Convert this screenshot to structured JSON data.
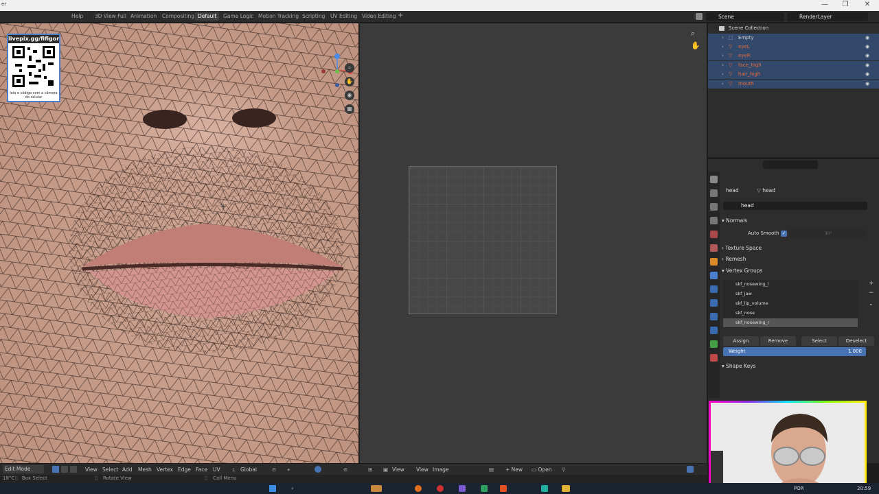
{
  "window": {
    "title_left": "er",
    "controls": [
      "—",
      "❐",
      "✕"
    ]
  },
  "menu": {
    "help": "Help"
  },
  "workspaces": [
    {
      "label": "3D View Full",
      "active": false
    },
    {
      "label": "Animation",
      "active": false
    },
    {
      "label": "Compositing",
      "active": false
    },
    {
      "label": "Default",
      "active": true
    },
    {
      "label": "Game Logic",
      "active": false
    },
    {
      "label": "Motion Tracking",
      "active": false
    },
    {
      "label": "Scripting",
      "active": false
    },
    {
      "label": "UV Editing",
      "active": false
    },
    {
      "label": "Video Editing",
      "active": false
    }
  ],
  "add_workspace": "+",
  "scene": {
    "label": "Scene"
  },
  "renderlayer": {
    "label": "RenderLayer"
  },
  "overlay": {
    "qr_header": "livepix.gg/fifigor",
    "qr_caption": "leia o código com a câmera do celular"
  },
  "outliner": {
    "root": "Scene Collection",
    "items": [
      {
        "label": "Empty",
        "color": "#e0e0e0"
      },
      {
        "label": "eyeL",
        "color": "#e86a3a"
      },
      {
        "label": "eyeR",
        "color": "#e86a3a"
      },
      {
        "label": "face_high",
        "color": "#e86a3a"
      },
      {
        "label": "hair_high",
        "color": "#e86a3a"
      },
      {
        "label": "mouth",
        "color": "#e86a3a"
      }
    ]
  },
  "properties": {
    "object_name": "head",
    "mesh_name": "head",
    "data_name": "head",
    "sections": {
      "normals": "Normals",
      "auto_smooth": "Auto Smooth",
      "angle": "30°",
      "texture_space": "Texture Space",
      "remesh": "Remesh",
      "vertex_groups": "Vertex Groups",
      "shape_keys": "Shape Keys"
    },
    "vertex_groups": [
      "skf_nosewing_l",
      "skf_jaw",
      "skf_lip_volume",
      "skf_nose",
      "skf_nosewing_r"
    ],
    "selected_group": 4,
    "buttons": {
      "assign": "Assign",
      "remove": "Remove",
      "select": "Select",
      "deselect": "Deselect"
    },
    "weight": {
      "label": "Weight",
      "value": "1.000"
    }
  },
  "bottom_header": {
    "mode": "Edit Mode",
    "view": "View",
    "select": "Select",
    "add": "Add",
    "mesh": "Mesh",
    "vertex": "Vertex",
    "edge": "Edge",
    "face": "Face",
    "uv": "UV",
    "orientation": "Global",
    "uv_view": "View",
    "uv_view2": "View",
    "uv_image": "Image",
    "uv_new": "New",
    "uv_open": "Open"
  },
  "status": {
    "temp": "18°C",
    "box_select": "Box Select",
    "rotate_view": "Rotate View",
    "call_menu": "Call Menu"
  },
  "taskbar": {
    "lang": "POR",
    "time": "20:59"
  }
}
